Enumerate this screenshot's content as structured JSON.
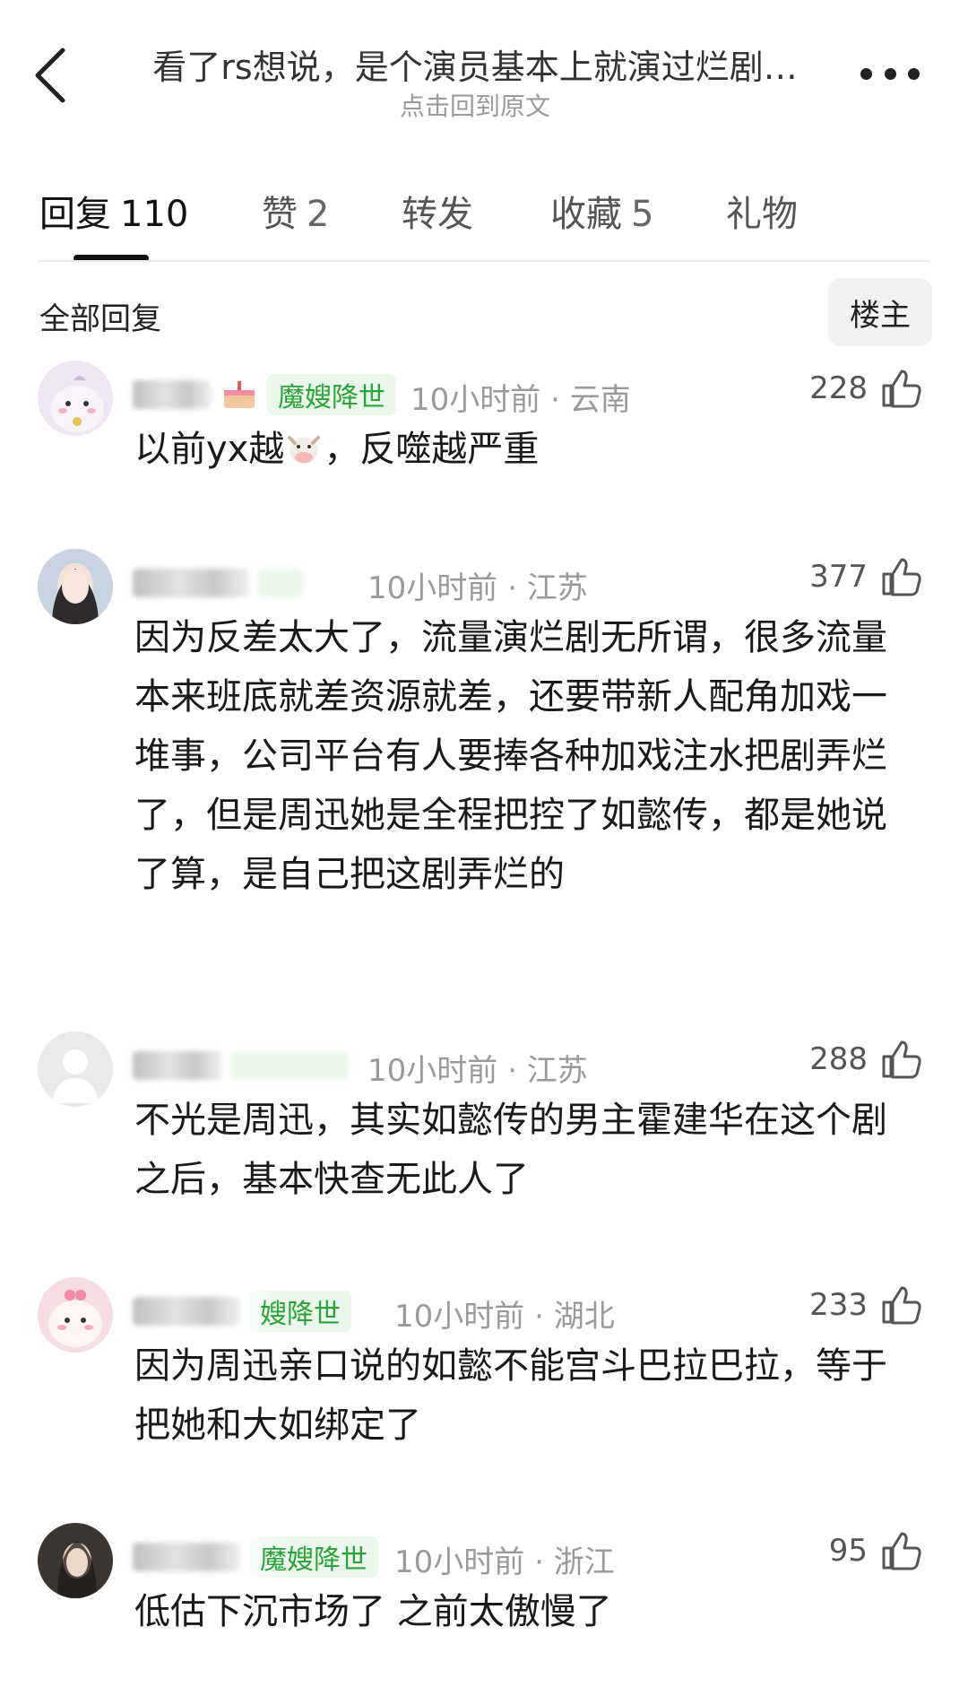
{
  "header": {
    "title": "看了rs想说，是个演员基本上就演过烂剧…",
    "subtitle": "点击回到原文",
    "back_icon": "chevron-left-icon",
    "more_icon": "more-dots-icon"
  },
  "tabs": [
    {
      "label": "回复",
      "count": "110",
      "active": true
    },
    {
      "label": "赞",
      "count": "2",
      "active": false
    },
    {
      "label": "转发",
      "count": "",
      "active": false
    },
    {
      "label": "收藏",
      "count": "5",
      "active": false
    },
    {
      "label": "礼物",
      "count": "",
      "active": false
    }
  ],
  "section": {
    "title": "全部回复",
    "filter_chip": "楼主"
  },
  "comments": [
    {
      "badge": "魔嫂降世",
      "time": "10小时前",
      "region": "云南",
      "likes": "228",
      "text_before": "以前yx越",
      "emoji": "cow-face-icon",
      "text_after": "，反噬越严重"
    },
    {
      "badge": "",
      "time": "10小时前",
      "region": "江苏",
      "likes": "377",
      "text": "因为反差太大了，流量演烂剧无所谓，很多流量本来班底就差资源就差，还要带新人配角加戏一堆事，公司平台有人要捧各种加戏注水把剧弄烂了，但是周迅她是全程把控了如懿传，都是她说了算，是自己把这剧弄烂的"
    },
    {
      "badge": "",
      "time": "10小时前",
      "region": "江苏",
      "likes": "288",
      "text": "不光是周迅，其实如懿传的男主霍建华在这个剧之后，基本快查无此人了"
    },
    {
      "badge": "嫂降世",
      "time": "10小时前",
      "region": "湖北",
      "likes": "233",
      "text": "因为周迅亲口说的如懿不能宫斗巴拉巴拉，等于把她和大如绑定了"
    },
    {
      "badge": "魔嫂降世",
      "time": "10小时前",
      "region": "浙江",
      "likes": "95",
      "text": "低估下沉市场了 之前太傲慢了"
    }
  ],
  "colors": {
    "badge_text": "#2aa33a",
    "badge_bg": "#eaf7ea",
    "meta": "#9a9a9a"
  }
}
